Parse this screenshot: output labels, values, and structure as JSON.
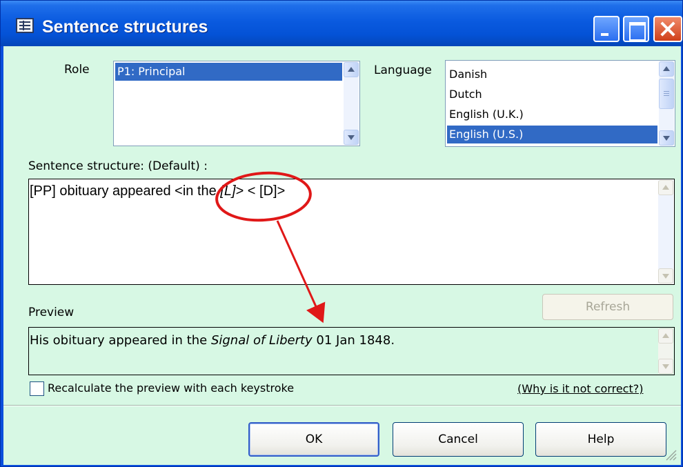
{
  "window": {
    "title": "Sentence structures"
  },
  "role": {
    "label": "Role",
    "items": [
      {
        "text": "P1: Principal",
        "selected": true
      }
    ]
  },
  "language": {
    "label": "Language",
    "items": [
      {
        "text": "Danish",
        "selected": false
      },
      {
        "text": "Dutch",
        "selected": false
      },
      {
        "text": "English (U.K.)",
        "selected": false
      },
      {
        "text": "English (U.S.)",
        "selected": true
      }
    ]
  },
  "sentence_structure": {
    "label": "Sentence structure: (Default) :",
    "value_before": "[PP] obituary appeared <in the ",
    "value_italic": "[L]",
    "value_after": "> < [D]>"
  },
  "preview": {
    "label": "Preview",
    "refresh_label": "Refresh",
    "text_before": "His obituary appeared in the ",
    "text_italic": "Signal of Liberty",
    "text_after": " 01 Jan 1848."
  },
  "recalculate": {
    "label": "Recalculate the preview with each keystroke",
    "checked": false
  },
  "why_link": "(Why is it not correct?)",
  "buttons": {
    "ok": "OK",
    "cancel": "Cancel",
    "help": "Help"
  },
  "colors": {
    "client_bg": "#d7f8e4",
    "title_blue": "#0452d6",
    "selection": "#316ac5",
    "annotation_red": "#e01818"
  },
  "icons": [
    "window-icon",
    "minimize-icon",
    "maximize-icon",
    "close-icon",
    "scroll-up-icon",
    "scroll-down-icon",
    "resize-grip-icon"
  ]
}
